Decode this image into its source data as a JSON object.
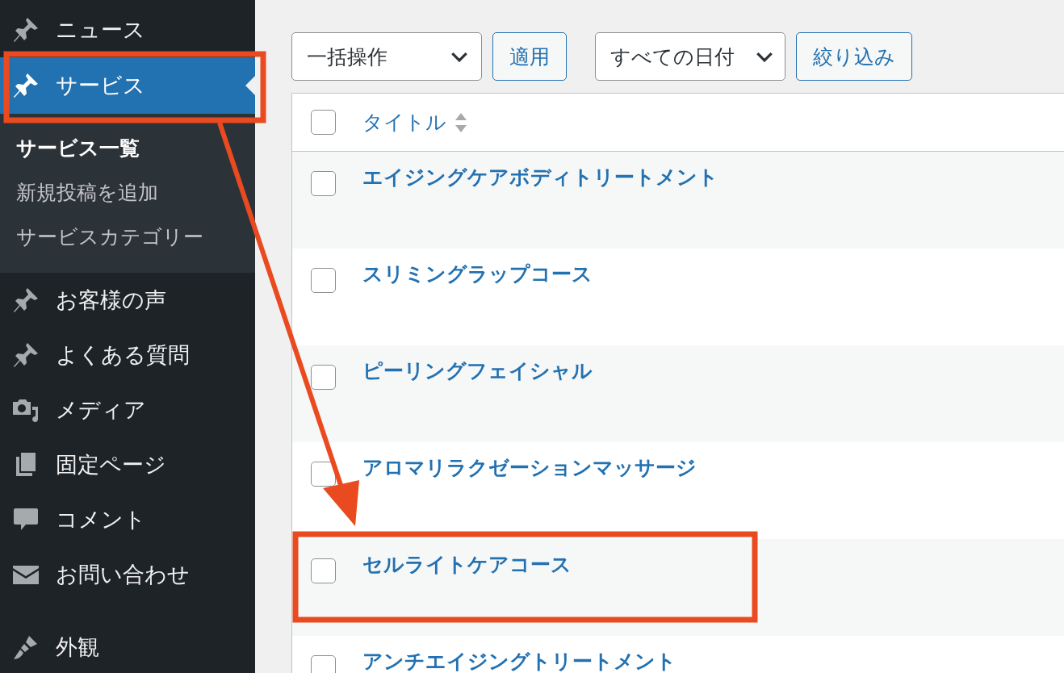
{
  "sidebar": {
    "groups": [
      {
        "items": [
          {
            "label": "ニュース",
            "kind": "pin",
            "selected": false
          },
          {
            "label": "サービス",
            "kind": "pin",
            "selected": true,
            "children": [
              {
                "label": "サービス一覧",
                "selected": true
              },
              {
                "label": "新規投稿を追加",
                "selected": false
              },
              {
                "label": "サービスカテゴリー",
                "selected": false
              }
            ]
          },
          {
            "label": "お客様の声",
            "kind": "pin",
            "selected": false
          },
          {
            "label": "よくある質問",
            "kind": "pin",
            "selected": false
          },
          {
            "label": "メディア",
            "kind": "media",
            "selected": false
          },
          {
            "label": "固定ページ",
            "kind": "pages",
            "selected": false
          },
          {
            "label": "コメント",
            "kind": "comment",
            "selected": false
          },
          {
            "label": "お問い合わせ",
            "kind": "mail",
            "selected": false
          }
        ]
      },
      {
        "items": [
          {
            "label": "外観",
            "kind": "brush",
            "selected": false
          }
        ]
      }
    ]
  },
  "toolbar": {
    "bulk_actions": {
      "value": "一括操作"
    },
    "apply_button": "適用",
    "date_filter": {
      "value": "すべての日付"
    },
    "filter_button": "絞り込み"
  },
  "table": {
    "select_all_checked": false,
    "columns": [
      {
        "label": "タイトル",
        "sortable": true
      }
    ],
    "rows": [
      {
        "title": "エイジングケアボディトリートメント",
        "checked": false
      },
      {
        "title": "スリミングラップコース",
        "checked": false
      },
      {
        "title": "ピーリングフェイシャル",
        "checked": false
      },
      {
        "title": "アロマリラクゼーションマッサージ",
        "checked": false
      },
      {
        "title": "セルライトケアコース",
        "checked": false
      },
      {
        "title": "アンチエイジングトリートメント",
        "checked": false
      }
    ]
  }
}
